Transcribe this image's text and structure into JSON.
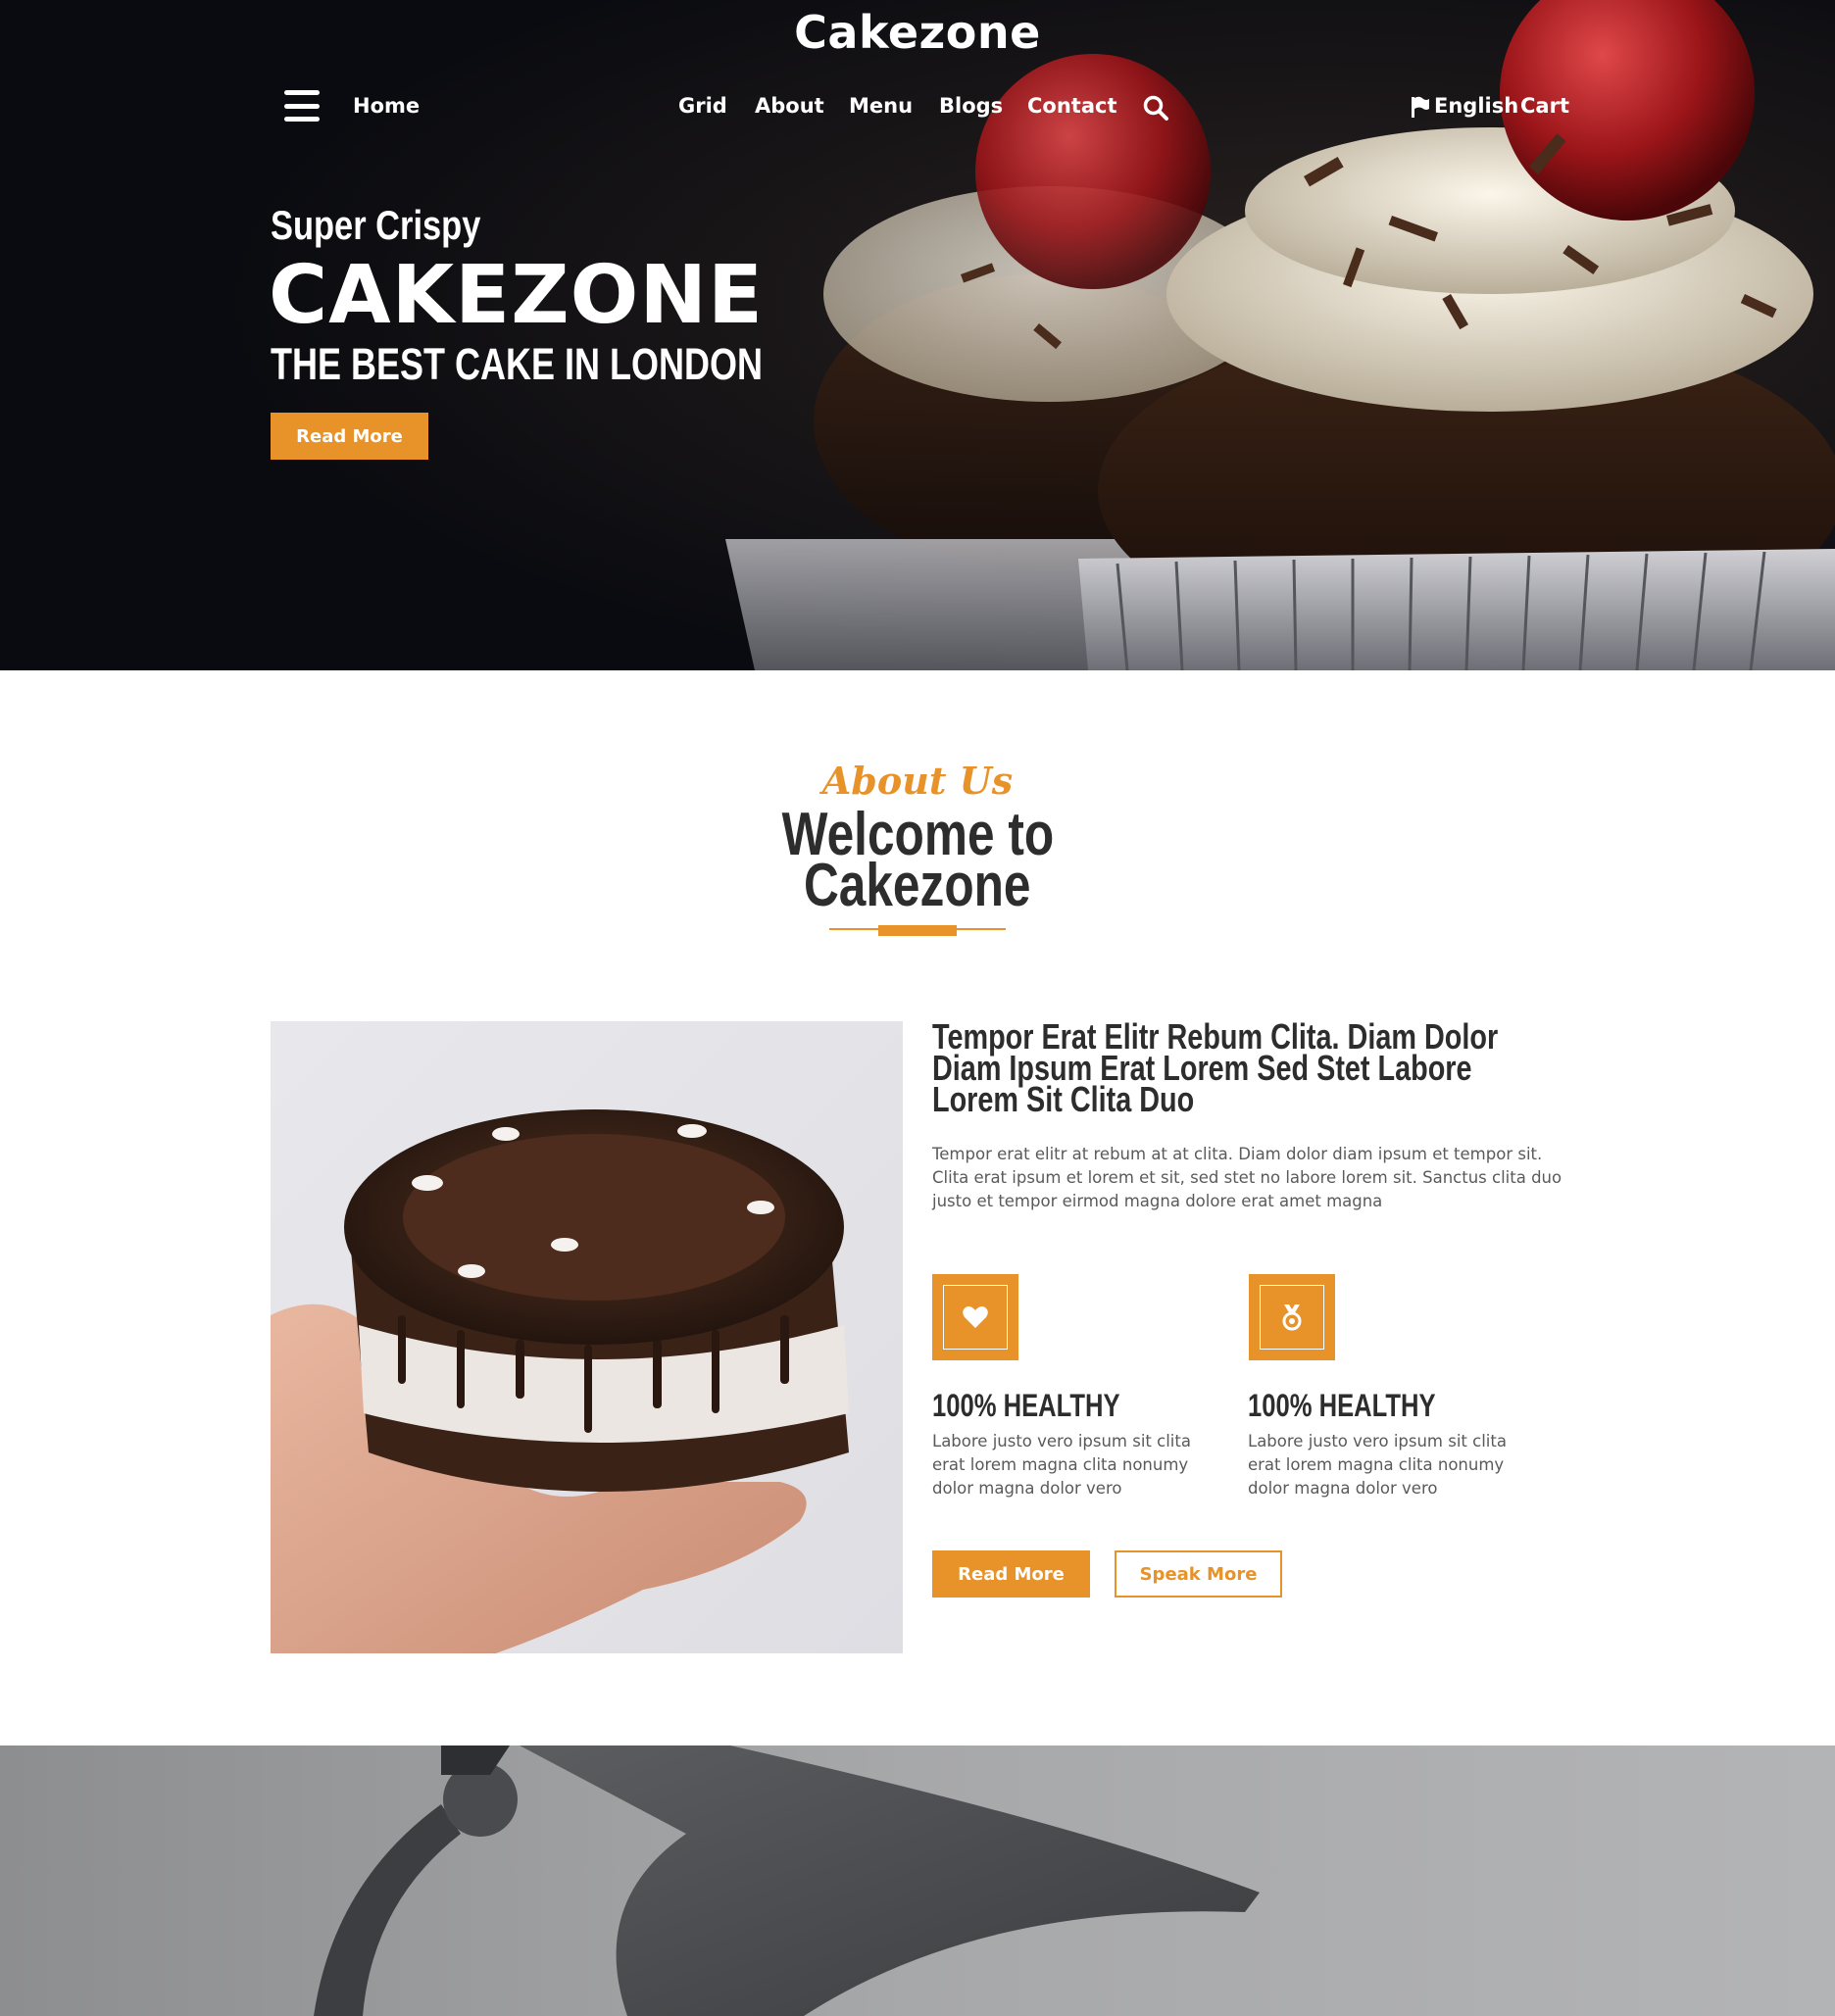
{
  "brand": "Cakezone",
  "nav": {
    "home": "Home",
    "grid": "Grid",
    "about": "About",
    "menu": "Menu",
    "blogs": "Blogs",
    "contact": "Contact",
    "language": "English",
    "cart": "Cart"
  },
  "hero": {
    "kicker": "Super Crispy",
    "title": "CAKEZONE",
    "subtitle": "THE BEST CAKE IN LONDON",
    "button": "Read More"
  },
  "about": {
    "kicker": "About Us",
    "title_line1": "Welcome to",
    "title_line2": "Cakezone",
    "heading": "Tempor Erat Elitr Rebum Clita. Diam Dolor Diam Ipsum Erat Lorem Sed Stet Labore Lorem Sit Clita Duo",
    "body": "Tempor erat elitr at rebum at at clita. Diam dolor diam ipsum et tempor sit. Clita erat ipsum et lorem et sit, sed stet no labore lorem sit. Sanctus clita duo justo et tempor eirmod magna dolore erat amet magna",
    "features": [
      {
        "icon": "heart-icon",
        "title": "100% HEALTHY",
        "text": "Labore justo vero ipsum sit clita erat lorem magna clita nonumy dolor magna dolor vero"
      },
      {
        "icon": "award-icon",
        "title": "100% HEALTHY",
        "text": "Labore justo vero ipsum sit clita erat lorem magna clita nonumy dolor magna dolor vero"
      }
    ],
    "read_more": "Read More",
    "speak_more": "Speak More"
  },
  "colors": {
    "accent": "#e8922a",
    "hero_bg": "#0a0b10",
    "text_dark": "#2d2d2d",
    "text_body": "#5a5a5a"
  }
}
